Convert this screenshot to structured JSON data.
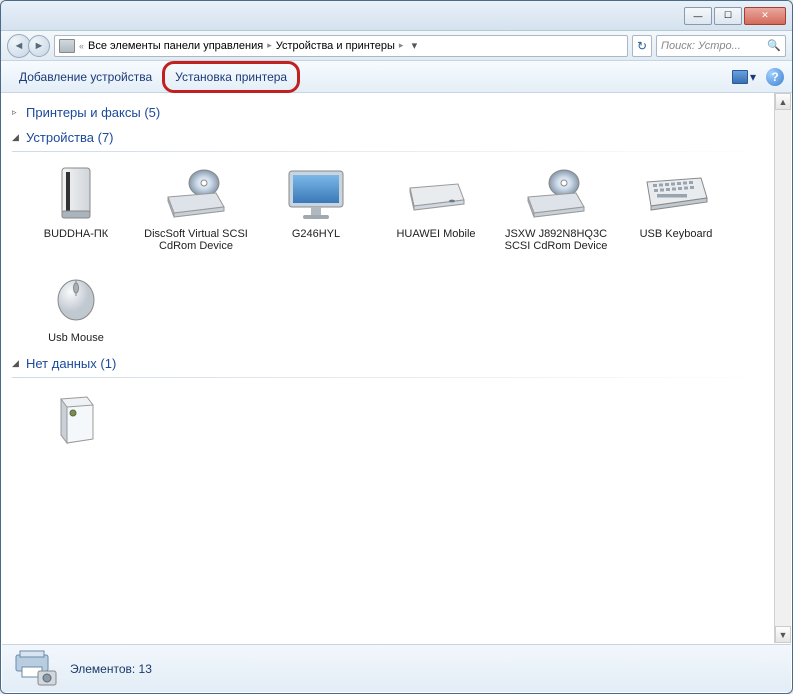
{
  "titlebar": {
    "minimize": "—",
    "maximize": "☐",
    "close": "✕"
  },
  "address": {
    "chevrons": "«",
    "crumb1": "Все элементы панели управления",
    "sep": "▸",
    "crumb2": "Устройства и принтеры",
    "dropdown": "▾",
    "refresh": "↻"
  },
  "search": {
    "placeholder": "Поиск: Устро...",
    "icon": "🔍"
  },
  "toolbar": {
    "add_device": "Добавление устройства",
    "add_printer": "Установка принтера",
    "view_dd": "▾",
    "help": "?"
  },
  "sections": {
    "printers": {
      "arrow": "▹",
      "label": "Принтеры и факсы (5)"
    },
    "devices": {
      "arrow": "◢",
      "label": "Устройства (7)"
    },
    "nodata": {
      "arrow": "◢",
      "label": "Нет данных (1)"
    }
  },
  "devices": [
    {
      "label": "BUDDHA-ПК"
    },
    {
      "label": "DiscSoft Virtual SCSI CdRom Device"
    },
    {
      "label": "G246HYL"
    },
    {
      "label": "HUAWEI Mobile"
    },
    {
      "label": "JSXW J892N8HQ3C SCSI CdRom Device"
    },
    {
      "label": "USB Keyboard"
    },
    {
      "label": "Usb Mouse"
    }
  ],
  "nodata_items": [
    {
      "label": ""
    }
  ],
  "statusbar": {
    "count_label": "Элементов: 13"
  }
}
